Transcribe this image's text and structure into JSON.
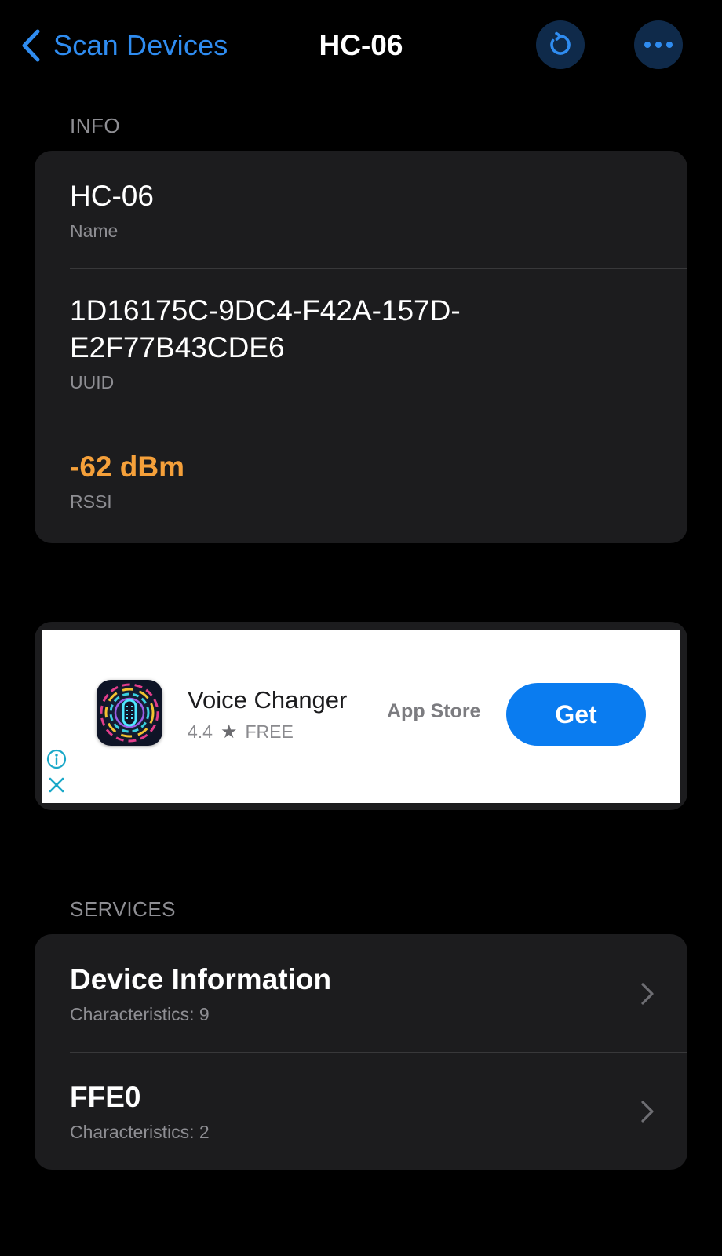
{
  "nav": {
    "back_label": "Scan Devices",
    "title": "HC-06",
    "accent": "#2f8cf0",
    "refresh_icon": "refresh-icon",
    "more_icon": "more-icon"
  },
  "info": {
    "header": "INFO",
    "name_value": "HC-06",
    "name_label": "Name",
    "uuid_value_line1": "1D16175C-9DC4-F42A-157D-",
    "uuid_value_line2": "E2F77B43CDE6",
    "uuid_label": "UUID",
    "rssi_value": "-62 dBm",
    "rssi_label": "RSSI",
    "rssi_color": "#f5a03a"
  },
  "ad": {
    "app_name": "Voice Changer",
    "rating": "4.4",
    "price": "FREE",
    "store": "App Store",
    "cta": "Get",
    "cta_color": "#0a7cf0"
  },
  "services": {
    "header": "SERVICES",
    "items": [
      {
        "title": "Device Information",
        "subtitle": "Characteristics: 9"
      },
      {
        "title": "FFE0",
        "subtitle": "Characteristics: 2"
      }
    ]
  }
}
